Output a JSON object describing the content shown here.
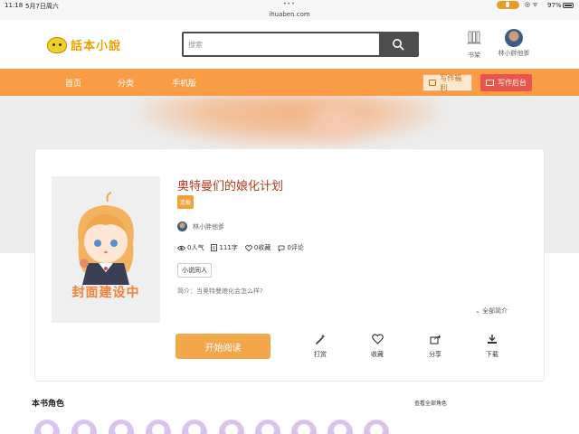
{
  "status_bar": {
    "time": "11:18",
    "date": "5月7日周六",
    "url": "ihuaben.com",
    "battery": "97%"
  },
  "header": {
    "logo_text": "話本小說",
    "search_placeholder": "搜索",
    "shelf_label": "书架",
    "user_name": "林小胖他爹"
  },
  "nav": {
    "items": [
      "首页",
      "分类",
      "手机版"
    ],
    "fuli_label": "写作福利",
    "admin_label": "写作后台",
    "color": "#f89c46"
  },
  "book": {
    "title": "奥特曼们的娘化计划",
    "status": "连载",
    "author": "林小胖他爹",
    "popularity": "0人气",
    "word_count": "111字",
    "favorites": "0收藏",
    "comments": "0评论",
    "tag": "小说同人",
    "intro": "简介：当奥特曼娘化会怎么样?",
    "intro_more": "全部简介",
    "cover_text": "封面建设中",
    "read_label": "开始阅读"
  },
  "actions": {
    "reward": "打赏",
    "favorite": "收藏",
    "share": "分享",
    "download": "下载"
  },
  "characters": {
    "title": "本书角色",
    "more": "查看全部角色"
  }
}
